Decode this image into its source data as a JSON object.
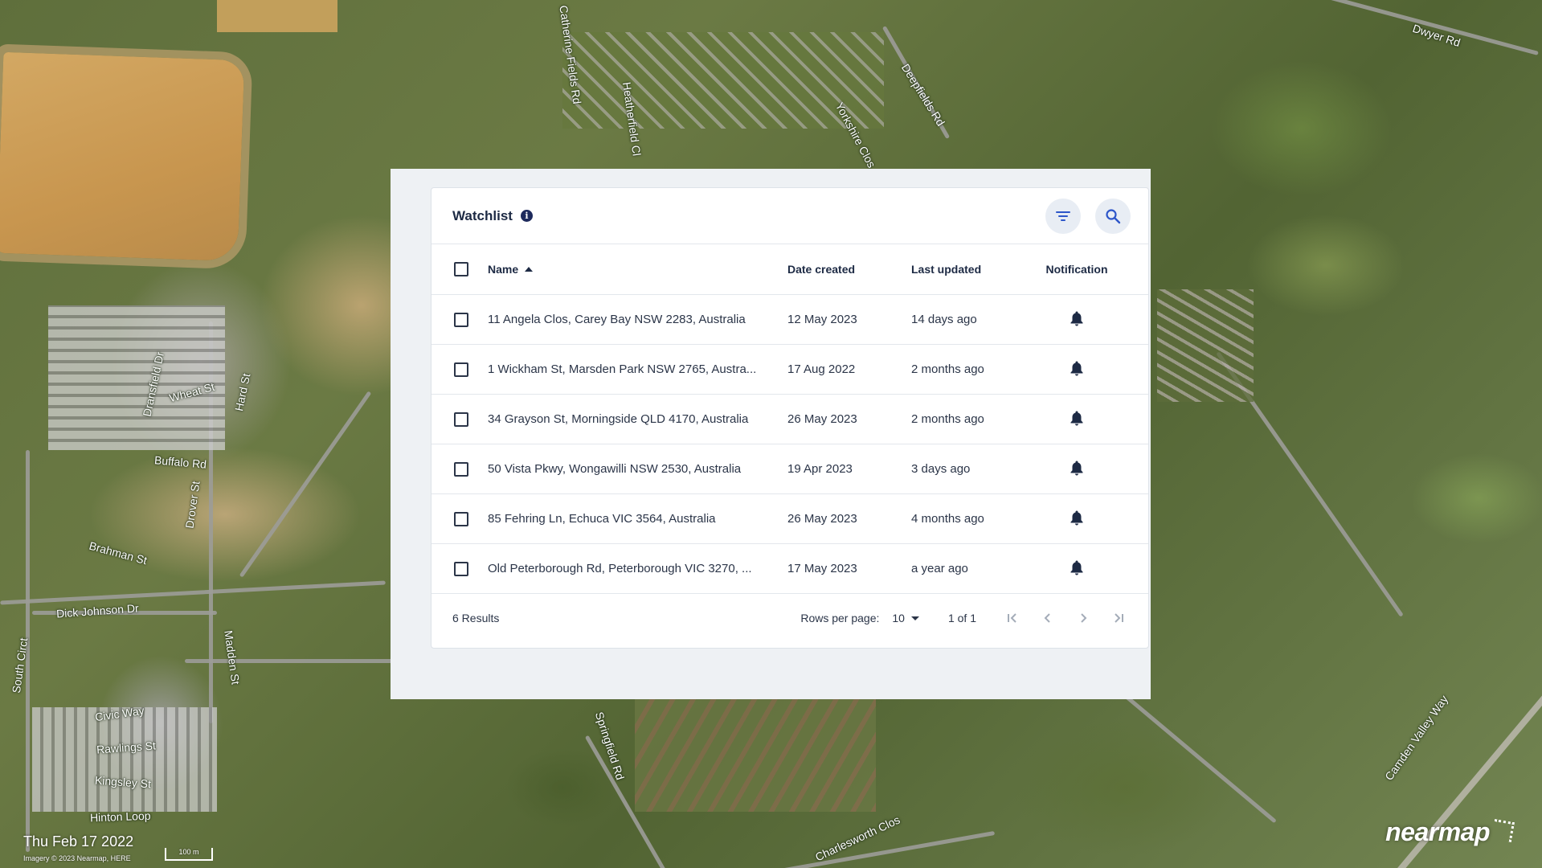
{
  "map": {
    "date": "Thu Feb 17 2022",
    "credit": "Imagery © 2023 Nearmap, HERE",
    "scale": "100 m",
    "logo": "nearmap",
    "street_labels": [
      "Catherine Fields Rd",
      "Heatherfield Cl",
      "Deepfields Rd",
      "Yorkshire Clos",
      "Dwyer Rd",
      "Dransfield Dr",
      "Wheat St",
      "Hard St",
      "Buffalo Rd",
      "Drover St",
      "Brahman St",
      "Dick Johnson Dr",
      "South Circt",
      "Civic Way",
      "Rawlings St",
      "Hinton Loop",
      "Kingsley St",
      "Madden St",
      "Springfield Rd",
      "Charlesworth Clos",
      "Camden Valley Way"
    ]
  },
  "watchlist": {
    "title": "Watchlist",
    "info_icon": "info-icon",
    "filter_icon": "filter-icon",
    "search_icon": "search-icon",
    "columns": {
      "name": "Name",
      "date_created": "Date created",
      "last_updated": "Last updated",
      "notification": "Notification"
    },
    "rows": [
      {
        "name": "11 Angela Clos, Carey Bay NSW 2283, Australia",
        "date_created": "12 May 2023",
        "last_updated": "14 days ago"
      },
      {
        "name": "1 Wickham St, Marsden Park NSW 2765, Austra...",
        "date_created": "17 Aug 2022",
        "last_updated": "2 months ago"
      },
      {
        "name": "34 Grayson St, Morningside QLD 4170, Australia",
        "date_created": "26 May 2023",
        "last_updated": "2 months ago"
      },
      {
        "name": "50 Vista Pkwy, Wongawilli NSW 2530, Australia",
        "date_created": "19 Apr 2023",
        "last_updated": "3 days ago"
      },
      {
        "name": "85 Fehring Ln, Echuca VIC 3564, Australia",
        "date_created": "26 May 2023",
        "last_updated": "4 months ago"
      },
      {
        "name": "Old Peterborough Rd, Peterborough VIC 3270, ...",
        "date_created": "17 May 2023",
        "last_updated": "a year ago"
      }
    ],
    "footer": {
      "results": "6 Results",
      "rows_per_page_label": "Rows per page:",
      "rows_per_page_value": "10",
      "page_of": "1 of 1"
    }
  }
}
